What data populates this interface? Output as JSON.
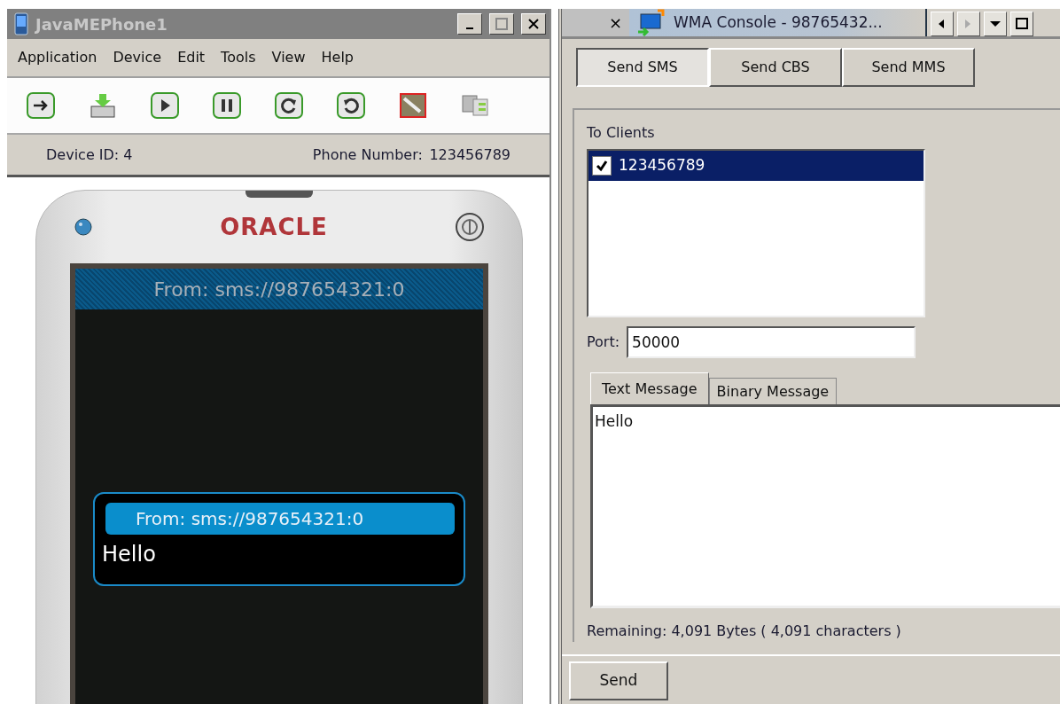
{
  "phone_window": {
    "title": "JavaMEPhone1",
    "menu": [
      "Application",
      "Device",
      "Edit",
      "Tools",
      "View",
      "Help"
    ],
    "device_id": "Device ID: 4",
    "phone_number_label": "Phone Number:",
    "phone_number": "123456789"
  },
  "phone": {
    "brand": "ORACLE",
    "screen_title": "From: sms://987654321:0",
    "alert_title": "From: sms://987654321:0",
    "alert_body": "Hello"
  },
  "console": {
    "close_tab": "×",
    "tab": {
      "title": "WMA Console - 98765432...",
      "selected": true
    },
    "send_modes": [
      {
        "label": "Send SMS",
        "selected": true
      },
      {
        "label": "Send CBS",
        "selected": false
      },
      {
        "label": "Send MMS",
        "selected": false
      }
    ],
    "to_clients_label": "To Clients",
    "clients": [
      {
        "number": "123456789",
        "checked": true,
        "selected": true
      }
    ],
    "port_label": "Port:",
    "port": "50000",
    "message_tabs": [
      {
        "label": "Text Message",
        "selected": true
      },
      {
        "label": "Binary Message",
        "selected": false
      }
    ],
    "message": "Hello",
    "remaining": "Remaining: 4,091 Bytes ( 4,091 characters )",
    "send_button": "Send"
  }
}
